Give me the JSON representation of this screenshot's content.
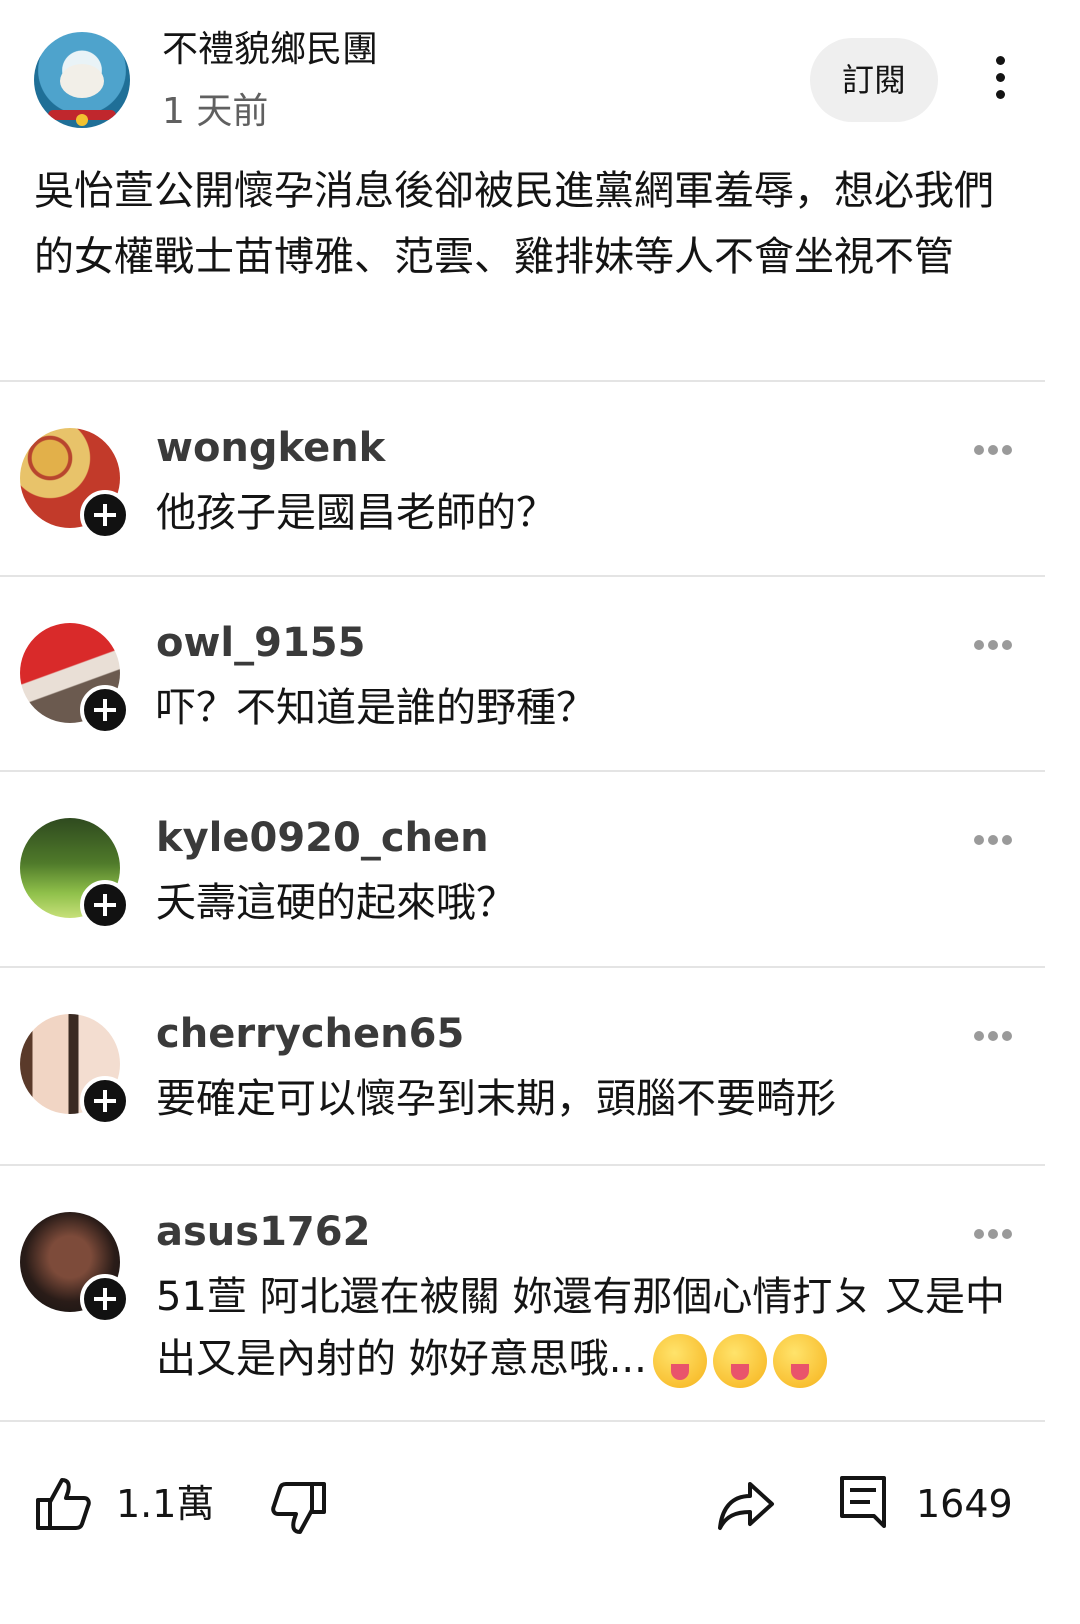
{
  "post": {
    "channel_name": "不禮貌鄉民團",
    "time_ago": "1 天前",
    "subscribe_label": "訂閱",
    "body": "吳怡萱公開懷孕消息後卻被民進黨網軍羞辱，想必我們的女權戰士苗博雅、范雲、雞排妹等人不會坐視不管"
  },
  "comments": [
    {
      "username": "wongkenk",
      "text": "他孩子是國昌老師的？",
      "avatar": "mooncake-avatar"
    },
    {
      "username": "owl_9155",
      "text": "吓？不知道是誰的野種？",
      "avatar": "photo-avatar"
    },
    {
      "username": "kyle0920_chen",
      "text": "夭壽這硬的起來哦？",
      "avatar": "forest-avatar"
    },
    {
      "username": "cherrychen65",
      "text": "要確定可以懷孕到末期，頭腦不要畸形",
      "avatar": "selfie-avatar"
    },
    {
      "username": "asus1762",
      "text": "51萱 阿北還在被關 妳還有那個心情打ㄆ 又是中出又是內射的 妳好意思哦...",
      "avatar": "tattoo-avatar"
    }
  ],
  "actions": {
    "like_count": "1.1萬",
    "comment_count": "1649"
  },
  "colors": {
    "text": "#141414",
    "muted": "#606060",
    "divider": "#e4e4e4",
    "pill": "#efefef"
  }
}
